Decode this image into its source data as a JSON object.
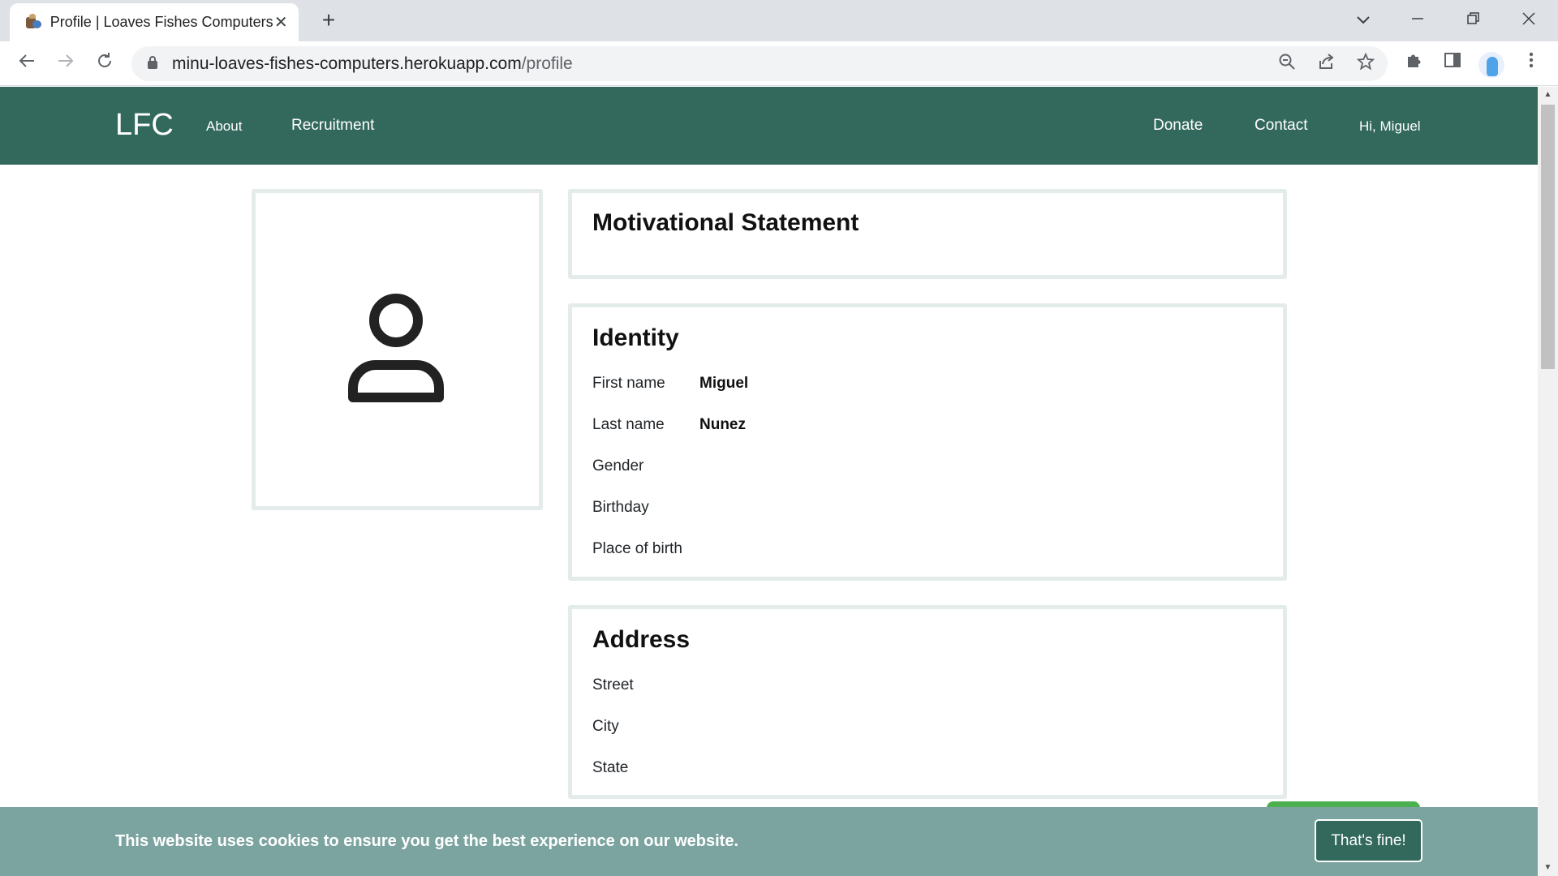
{
  "browser": {
    "tab_title": "Profile | Loaves Fishes Computers",
    "url_domain": "minu-loaves-fishes-computers.herokuapp.com",
    "url_path": "/profile"
  },
  "site_nav": {
    "brand": "LFC",
    "left_links": [
      "About",
      "Recruitment"
    ],
    "right_links": [
      "Donate",
      "Contact"
    ],
    "greeting": "Hi, Miguel"
  },
  "profile": {
    "motivation": {
      "title": "Motivational Statement"
    },
    "identity": {
      "title": "Identity",
      "fields": [
        {
          "label": "First name",
          "value": "Miguel"
        },
        {
          "label": "Last name",
          "value": "Nunez"
        },
        {
          "label": "Gender",
          "value": ""
        },
        {
          "label": "Birthday",
          "value": ""
        },
        {
          "label": "Place of birth",
          "value": ""
        }
      ]
    },
    "address": {
      "title": "Address",
      "fields": [
        {
          "label": "Street",
          "value": ""
        },
        {
          "label": "City",
          "value": ""
        },
        {
          "label": "State",
          "value": ""
        }
      ]
    }
  },
  "cookie_banner": {
    "message": "This website uses cookies to ensure you get the best experience on our website.",
    "accept_label": "That's fine!"
  },
  "colors": {
    "nav_bg": "#33695c",
    "cookie_bg": "#7ba4a0",
    "card_border": "#e3ecea",
    "accent_green": "#4caf50"
  }
}
